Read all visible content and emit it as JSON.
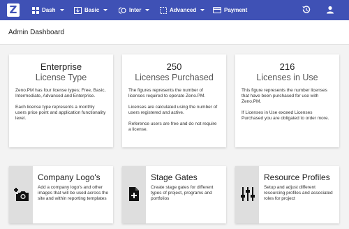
{
  "nav": {
    "logo": "Z",
    "items": [
      {
        "label": "Dash",
        "icon": "dashboard-icon"
      },
      {
        "label": "Basic",
        "icon": "basic-icon"
      },
      {
        "label": "Inter",
        "icon": "inter-icon"
      },
      {
        "label": "Advanced",
        "icon": "advanced-icon"
      },
      {
        "label": "Payment",
        "icon": "payment-icon"
      }
    ],
    "right_icons": [
      "history-icon",
      "account-icon"
    ],
    "color": "#3f51b5"
  },
  "page_title": "Admin Dashboard",
  "license_cards": [
    {
      "title": "Enterprise",
      "subtitle": "License Type",
      "paragraphs": [
        "Zeno.PM has four license types; Free, Basic, Intermediate, Advanced and Enterprise.",
        "Each license type represents a monthly users price point and application functionality level."
      ]
    },
    {
      "title": "250",
      "subtitle": "Licenses Purchased",
      "paragraphs": [
        "The figures represents the number of licenses required to operate Zeno.PM.",
        "Licenses are calculated using the number of users registered and active.",
        "Reference users are free and do not require a license."
      ]
    },
    {
      "title": "216",
      "subtitle": "Licenses in Use",
      "paragraphs": [
        "This figure represents the number licenses that have been purchased for use with Zeno.PM.",
        "If Licenses in Use exceed Licenses Purchased you are obligated to order more."
      ]
    }
  ],
  "feature_cards": [
    {
      "title": "Company Logo's",
      "description": "Add a company logo's and other images that will be used across the site and within reporting templates",
      "icon": "add-photo-icon"
    },
    {
      "title": "Stage Gates",
      "description": "Create stage gates for different types of project, programs and portfolios",
      "icon": "add-document-icon"
    },
    {
      "title": "Resource Profiles",
      "description": "Setup and adjust different resourcing profiles and associated roles for project",
      "icon": "sliders-icon"
    }
  ]
}
